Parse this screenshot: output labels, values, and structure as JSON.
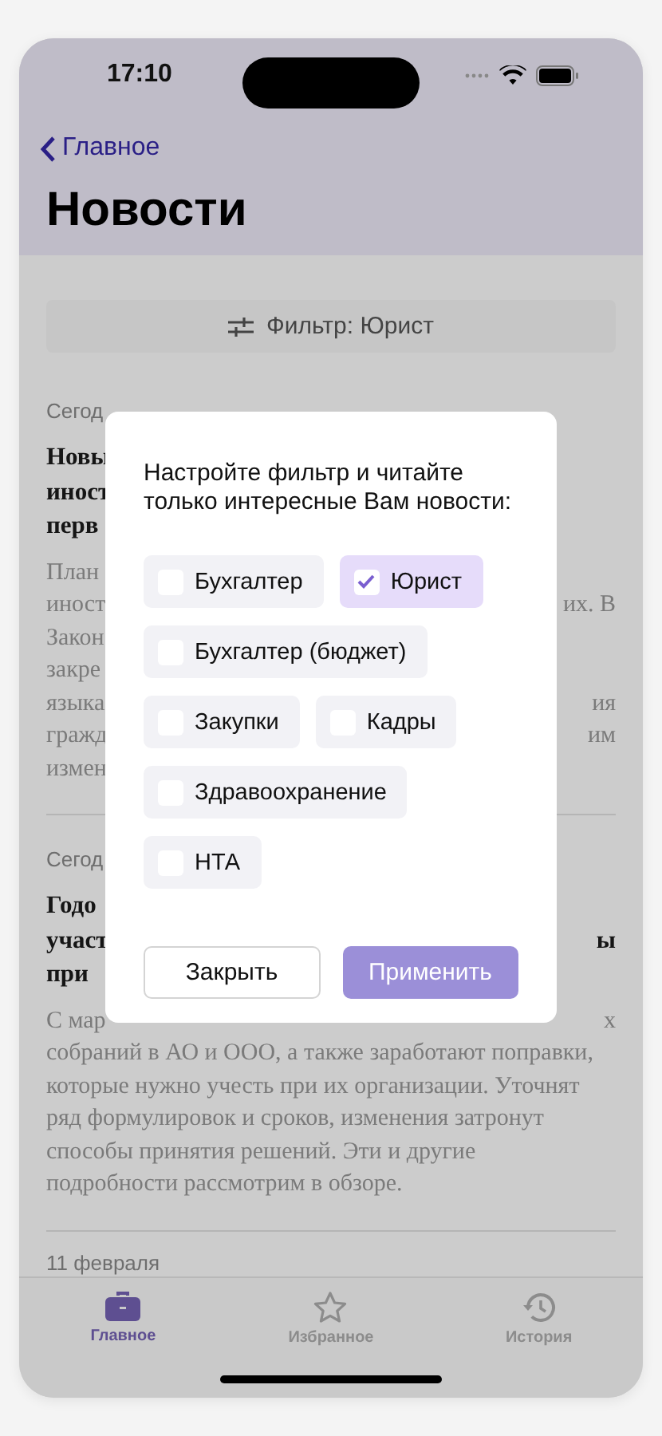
{
  "status_bar": {
    "time": "17:10"
  },
  "nav": {
    "back": "Главное",
    "title": "Новости"
  },
  "filter_button": {
    "label": "Фильтр: Юрист"
  },
  "articles": [
    {
      "date": "Сегод",
      "title_lines": [
        {
          "start": "Новы"
        },
        {
          "start": "иност"
        },
        {
          "start": "перв"
        }
      ],
      "body_lines": [
        {
          "start": "План"
        },
        {
          "start": "иност",
          "end": "их. В"
        },
        {
          "start": "Закон"
        },
        {
          "start": "закре"
        },
        {
          "start": "языка",
          "end": "ия"
        },
        {
          "start": "гражд",
          "end": "им"
        },
        {
          "start": "измен"
        }
      ]
    },
    {
      "date": "Сегод",
      "title_lines": [
        {
          "start": "Годо"
        },
        {
          "start": "участ",
          "end": "ы"
        },
        {
          "start": "при"
        }
      ],
      "body_lines": [
        {
          "start": "С мар",
          "end": "х"
        },
        {
          "start": "собраний в АО и ООО, а также заработают поправки,"
        },
        {
          "start": "которые нужно учесть при их организации. Уточнят"
        },
        {
          "start": "ряд формулировок и сроков, изменения затронут"
        },
        {
          "start": "способы принятия решений. Эти и другие"
        },
        {
          "start": "подробности рассмотрим в обзоре."
        }
      ]
    },
    {
      "date": "11 февраля"
    }
  ],
  "filter_dialog": {
    "prompt": "Настройте фильтр и читайте только интересные Вам новости:",
    "options": [
      {
        "label": "Бухгалтер",
        "checked": false
      },
      {
        "label": "Юрист",
        "checked": true
      },
      {
        "label": "Бухгалтер (бюджет)",
        "checked": false
      },
      {
        "label": "Закупки",
        "checked": false
      },
      {
        "label": "Кадры",
        "checked": false
      },
      {
        "label": "Здравоохранение",
        "checked": false
      },
      {
        "label": "НТА",
        "checked": false
      }
    ],
    "buttons": [
      {
        "label": "Закрыть",
        "kind": "secondary"
      },
      {
        "label": "Применить",
        "kind": "primary"
      }
    ]
  },
  "tab_bar": [
    {
      "label": "Главное",
      "kind": "briefcase",
      "selected": true
    },
    {
      "label": "Избранное",
      "kind": "star",
      "selected": false
    },
    {
      "label": "История",
      "kind": "history",
      "selected": false
    }
  ]
}
